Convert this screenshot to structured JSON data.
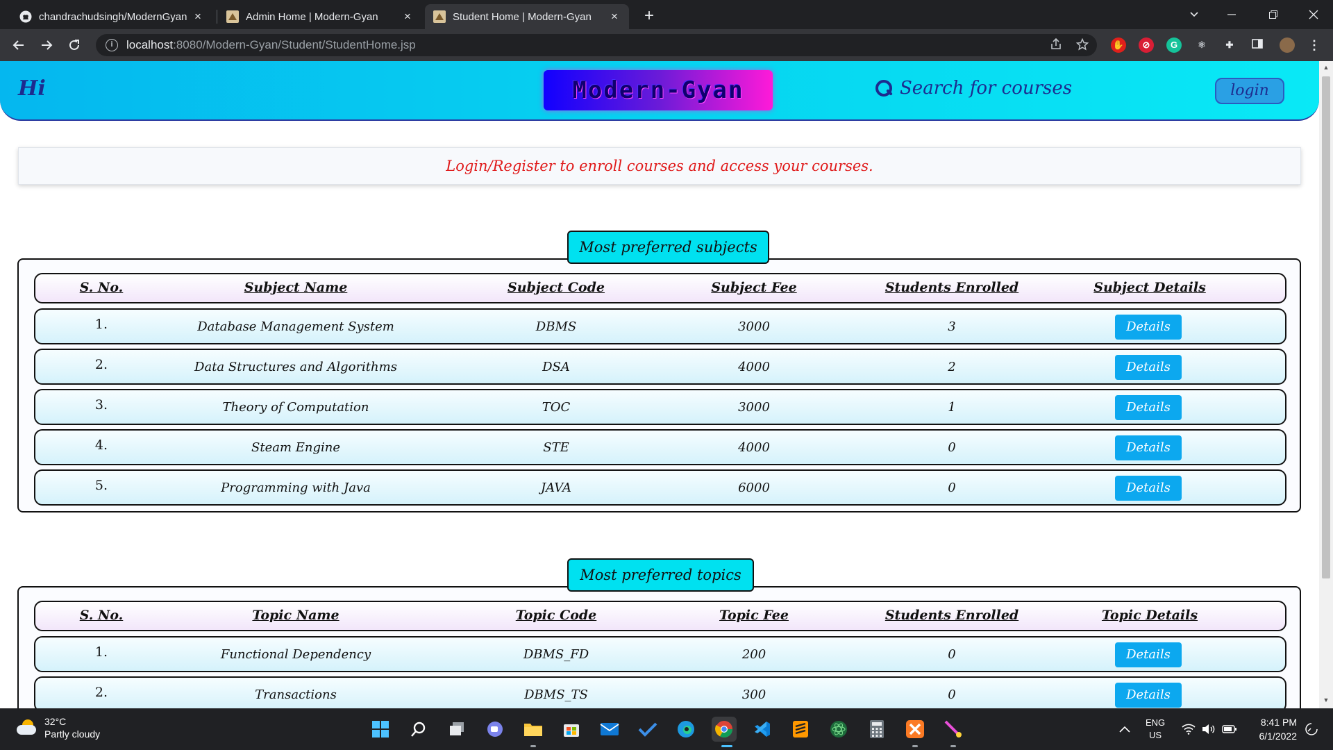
{
  "browser": {
    "tabs": [
      {
        "title": "chandrachudsingh/ModernGyan",
        "favicon": "github-icon",
        "close": "×"
      },
      {
        "title": "Admin Home | Modern-Gyan",
        "favicon": "site-favicon-icon",
        "close": "×"
      },
      {
        "title": "Student Home | Modern-Gyan",
        "favicon": "site-favicon-icon",
        "close": "×"
      }
    ],
    "new_tab": "+",
    "url_host": "localhost",
    "url_path": ":8080/Modern-Gyan/Student/StudentHome.jsp"
  },
  "header": {
    "greeting": "Hi",
    "logo_text": "Modern-Gyan",
    "search_placeholder": "Search for courses",
    "login_label": "login"
  },
  "notice": "Login/Register to enroll courses and access your courses.",
  "subjects": {
    "title": "Most preferred subjects",
    "columns": [
      "S. No.",
      "Subject Name",
      "Subject Code",
      "Subject Fee",
      "Students Enrolled",
      "Subject Details"
    ],
    "rows": [
      {
        "sno": "1.",
        "name": "Database Management System",
        "code": "DBMS",
        "fee": "3000",
        "enrolled": "3",
        "action": "Details"
      },
      {
        "sno": "2.",
        "name": "Data Structures and Algorithms",
        "code": "DSA",
        "fee": "4000",
        "enrolled": "2",
        "action": "Details"
      },
      {
        "sno": "3.",
        "name": "Theory of Computation",
        "code": "TOC",
        "fee": "3000",
        "enrolled": "1",
        "action": "Details"
      },
      {
        "sno": "4.",
        "name": "Steam Engine",
        "code": "STE",
        "fee": "4000",
        "enrolled": "0",
        "action": "Details"
      },
      {
        "sno": "5.",
        "name": "Programming with Java",
        "code": "JAVA",
        "fee": "6000",
        "enrolled": "0",
        "action": "Details"
      }
    ]
  },
  "topics": {
    "title": "Most preferred topics",
    "columns": [
      "S. No.",
      "Topic Name",
      "Topic Code",
      "Topic Fee",
      "Students Enrolled",
      "Topic Details"
    ],
    "rows": [
      {
        "sno": "1.",
        "name": "Functional Dependency",
        "code": "DBMS_FD",
        "fee": "200",
        "enrolled": "0",
        "action": "Details"
      },
      {
        "sno": "2.",
        "name": "Transactions",
        "code": "DBMS_TS",
        "fee": "300",
        "enrolled": "0",
        "action": "Details"
      }
    ]
  },
  "taskbar": {
    "weather_temp": "32°C",
    "weather_desc": "Partly cloudy",
    "lang_1": "ENG",
    "lang_2": "US",
    "time": "8:41 PM",
    "date": "6/1/2022"
  },
  "colors": {
    "header_gradient_start": "#05b7ef",
    "header_gradient_end": "#09e9f6",
    "notice_text": "#e01a1a",
    "section_title_bg": "#00e1f0",
    "details_button": "#0ca8ef",
    "brand_text": "#1d2b8f"
  }
}
